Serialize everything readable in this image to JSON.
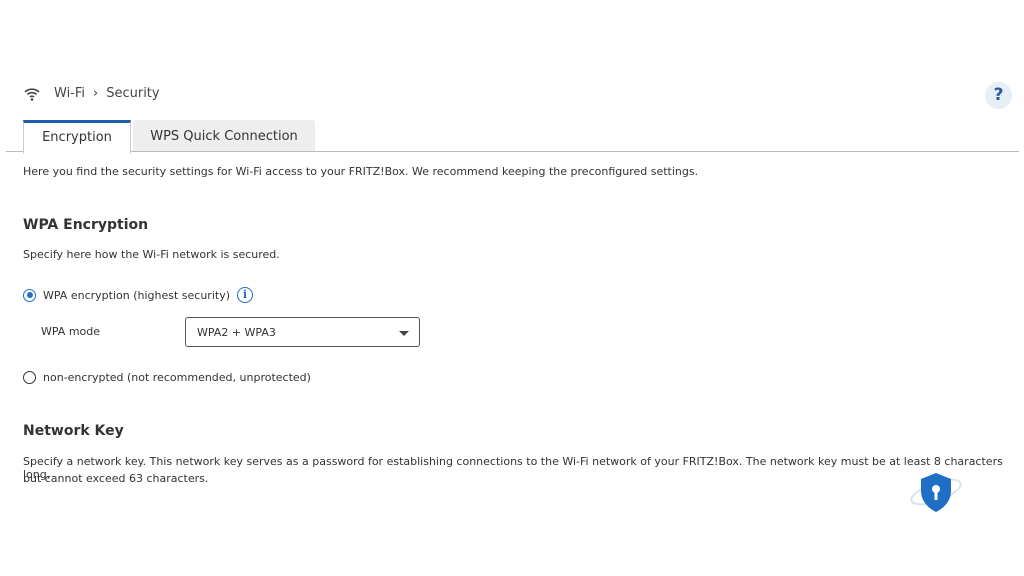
{
  "breadcrumb": {
    "icon": "wifi-icon",
    "items": [
      "Wi-Fi",
      "Security"
    ]
  },
  "help": {
    "label": "?"
  },
  "tabs": [
    {
      "label": "Encryption",
      "active": true
    },
    {
      "label": "WPS Quick Connection",
      "active": false
    }
  ],
  "intro": "Here you find the security settings for Wi-Fi access to your FRITZ!Box. We recommend keeping the preconfigured settings.",
  "wpa": {
    "title": "WPA Encryption",
    "desc": "Specify here how the Wi-Fi network is secured.",
    "option_encrypted": "WPA encryption (highest security)",
    "mode_label": "WPA mode",
    "mode_value": "WPA2 + WPA3",
    "option_unencrypted": "non-encrypted (not recommended, unprotected)",
    "selected": "encrypted"
  },
  "key": {
    "title": "Network Key",
    "desc1": "Specify a network key. This network key serves as a password for establishing connections to the Wi-Fi network of your FRITZ!Box. The network key must be at least 8 characters long,",
    "desc2": "but cannot exceed 63 characters."
  },
  "colors": {
    "accent": "#1f6fc4"
  }
}
